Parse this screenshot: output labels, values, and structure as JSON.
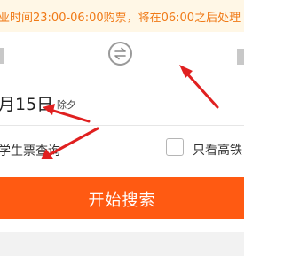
{
  "notice": {
    "text": "业时间23:00-06:00购票，将在06:00之后处理"
  },
  "date": {
    "main": "月15日",
    "sub": "除夕"
  },
  "options": {
    "student_label": "学生票查询",
    "high_speed_label": "只看高铁"
  },
  "search_button": {
    "label": "开始搜索"
  },
  "colors": {
    "accent": "#ff5a12",
    "notice_text": "#f07a17",
    "notice_bg": "#fff7e6",
    "annotation_arrow": "#e02020"
  },
  "icons": {
    "swap": "swap-arrows-icon",
    "checkbox": "checkbox-empty-icon"
  }
}
